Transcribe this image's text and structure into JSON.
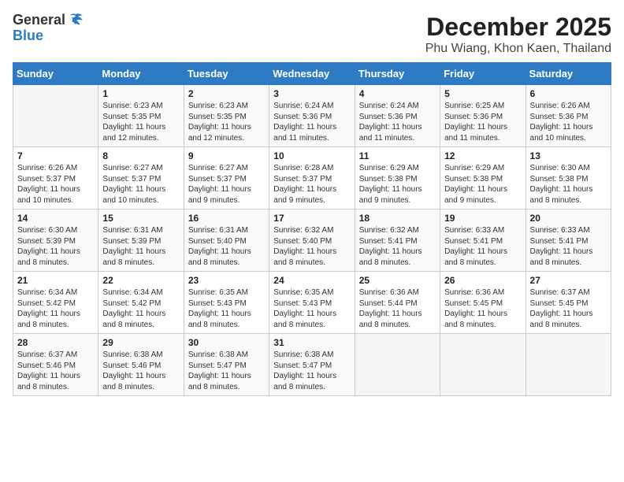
{
  "logo": {
    "line1": "General",
    "line2": "Blue"
  },
  "title": "December 2025",
  "subtitle": "Phu Wiang, Khon Kaen, Thailand",
  "days_of_week": [
    "Sunday",
    "Monday",
    "Tuesday",
    "Wednesday",
    "Thursday",
    "Friday",
    "Saturday"
  ],
  "weeks": [
    [
      {
        "day": "",
        "info": ""
      },
      {
        "day": "1",
        "info": "Sunrise: 6:23 AM\nSunset: 5:35 PM\nDaylight: 11 hours\nand 12 minutes."
      },
      {
        "day": "2",
        "info": "Sunrise: 6:23 AM\nSunset: 5:35 PM\nDaylight: 11 hours\nand 12 minutes."
      },
      {
        "day": "3",
        "info": "Sunrise: 6:24 AM\nSunset: 5:36 PM\nDaylight: 11 hours\nand 11 minutes."
      },
      {
        "day": "4",
        "info": "Sunrise: 6:24 AM\nSunset: 5:36 PM\nDaylight: 11 hours\nand 11 minutes."
      },
      {
        "day": "5",
        "info": "Sunrise: 6:25 AM\nSunset: 5:36 PM\nDaylight: 11 hours\nand 11 minutes."
      },
      {
        "day": "6",
        "info": "Sunrise: 6:26 AM\nSunset: 5:36 PM\nDaylight: 11 hours\nand 10 minutes."
      }
    ],
    [
      {
        "day": "7",
        "info": "Sunrise: 6:26 AM\nSunset: 5:37 PM\nDaylight: 11 hours\nand 10 minutes."
      },
      {
        "day": "8",
        "info": "Sunrise: 6:27 AM\nSunset: 5:37 PM\nDaylight: 11 hours\nand 10 minutes."
      },
      {
        "day": "9",
        "info": "Sunrise: 6:27 AM\nSunset: 5:37 PM\nDaylight: 11 hours\nand 9 minutes."
      },
      {
        "day": "10",
        "info": "Sunrise: 6:28 AM\nSunset: 5:37 PM\nDaylight: 11 hours\nand 9 minutes."
      },
      {
        "day": "11",
        "info": "Sunrise: 6:29 AM\nSunset: 5:38 PM\nDaylight: 11 hours\nand 9 minutes."
      },
      {
        "day": "12",
        "info": "Sunrise: 6:29 AM\nSunset: 5:38 PM\nDaylight: 11 hours\nand 9 minutes."
      },
      {
        "day": "13",
        "info": "Sunrise: 6:30 AM\nSunset: 5:38 PM\nDaylight: 11 hours\nand 8 minutes."
      }
    ],
    [
      {
        "day": "14",
        "info": "Sunrise: 6:30 AM\nSunset: 5:39 PM\nDaylight: 11 hours\nand 8 minutes."
      },
      {
        "day": "15",
        "info": "Sunrise: 6:31 AM\nSunset: 5:39 PM\nDaylight: 11 hours\nand 8 minutes."
      },
      {
        "day": "16",
        "info": "Sunrise: 6:31 AM\nSunset: 5:40 PM\nDaylight: 11 hours\nand 8 minutes."
      },
      {
        "day": "17",
        "info": "Sunrise: 6:32 AM\nSunset: 5:40 PM\nDaylight: 11 hours\nand 8 minutes."
      },
      {
        "day": "18",
        "info": "Sunrise: 6:32 AM\nSunset: 5:41 PM\nDaylight: 11 hours\nand 8 minutes."
      },
      {
        "day": "19",
        "info": "Sunrise: 6:33 AM\nSunset: 5:41 PM\nDaylight: 11 hours\nand 8 minutes."
      },
      {
        "day": "20",
        "info": "Sunrise: 6:33 AM\nSunset: 5:41 PM\nDaylight: 11 hours\nand 8 minutes."
      }
    ],
    [
      {
        "day": "21",
        "info": "Sunrise: 6:34 AM\nSunset: 5:42 PM\nDaylight: 11 hours\nand 8 minutes."
      },
      {
        "day": "22",
        "info": "Sunrise: 6:34 AM\nSunset: 5:42 PM\nDaylight: 11 hours\nand 8 minutes."
      },
      {
        "day": "23",
        "info": "Sunrise: 6:35 AM\nSunset: 5:43 PM\nDaylight: 11 hours\nand 8 minutes."
      },
      {
        "day": "24",
        "info": "Sunrise: 6:35 AM\nSunset: 5:43 PM\nDaylight: 11 hours\nand 8 minutes."
      },
      {
        "day": "25",
        "info": "Sunrise: 6:36 AM\nSunset: 5:44 PM\nDaylight: 11 hours\nand 8 minutes."
      },
      {
        "day": "26",
        "info": "Sunrise: 6:36 AM\nSunset: 5:45 PM\nDaylight: 11 hours\nand 8 minutes."
      },
      {
        "day": "27",
        "info": "Sunrise: 6:37 AM\nSunset: 5:45 PM\nDaylight: 11 hours\nand 8 minutes."
      }
    ],
    [
      {
        "day": "28",
        "info": "Sunrise: 6:37 AM\nSunset: 5:46 PM\nDaylight: 11 hours\nand 8 minutes."
      },
      {
        "day": "29",
        "info": "Sunrise: 6:38 AM\nSunset: 5:46 PM\nDaylight: 11 hours\nand 8 minutes."
      },
      {
        "day": "30",
        "info": "Sunrise: 6:38 AM\nSunset: 5:47 PM\nDaylight: 11 hours\nand 8 minutes."
      },
      {
        "day": "31",
        "info": "Sunrise: 6:38 AM\nSunset: 5:47 PM\nDaylight: 11 hours\nand 8 minutes."
      },
      {
        "day": "",
        "info": ""
      },
      {
        "day": "",
        "info": ""
      },
      {
        "day": "",
        "info": ""
      }
    ]
  ]
}
